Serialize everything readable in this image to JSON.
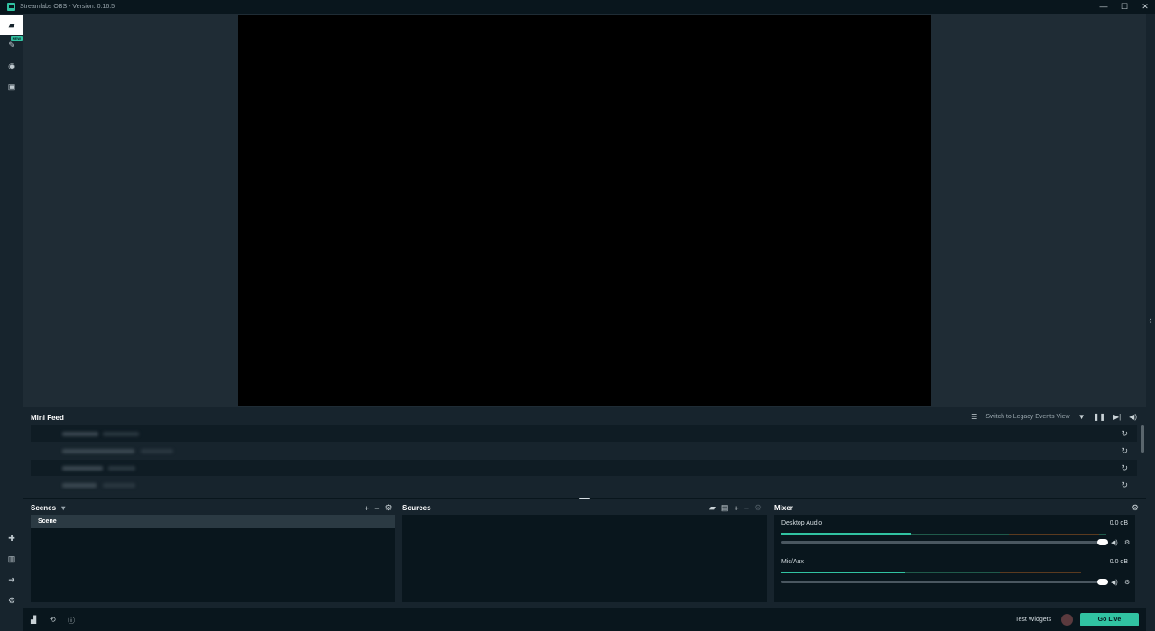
{
  "window": {
    "title": "Streamlabs OBS - Version: 0.16.5",
    "controls": {
      "minimize": "—",
      "maximize": "☐",
      "close": "✕"
    }
  },
  "leftnav": {
    "items": [
      {
        "name": "editor-icon",
        "glyph": "▰",
        "active": true
      },
      {
        "name": "themes-icon",
        "glyph": "✎",
        "badge": "NEW"
      },
      {
        "name": "dashboard-icon",
        "glyph": "◉"
      },
      {
        "name": "store-icon",
        "glyph": "▣"
      }
    ],
    "bottom_items": [
      {
        "name": "studio-mode-icon",
        "glyph": "✚"
      },
      {
        "name": "layout-icon",
        "glyph": "▥"
      },
      {
        "name": "logout-icon",
        "glyph": "➜"
      },
      {
        "name": "settings-icon",
        "glyph": "⚙"
      }
    ]
  },
  "minifeed": {
    "title": "Mini Feed",
    "legacy_link": "Switch to Legacy Events View",
    "tools": [
      "filter-icon",
      "pause-icon",
      "skip-icon",
      "mute-icon"
    ]
  },
  "scenes": {
    "title": "Scenes",
    "dropdown_glyph": "▾",
    "items": [
      "Scene"
    ]
  },
  "sources": {
    "title": "Sources"
  },
  "mixer": {
    "title": "Mixer",
    "channels": [
      {
        "label": "Desktop Audio",
        "db": "0.0 dB",
        "level": 0.4
      },
      {
        "label": "Mic/Aux",
        "db": "0.0 dB",
        "level": 0.38
      }
    ]
  },
  "footer": {
    "test_widgets": "Test Widgets",
    "go_live": "Go Live"
  },
  "colors": {
    "accent": "#31c3a2",
    "background": "#09161d",
    "panel": "#17242d"
  }
}
